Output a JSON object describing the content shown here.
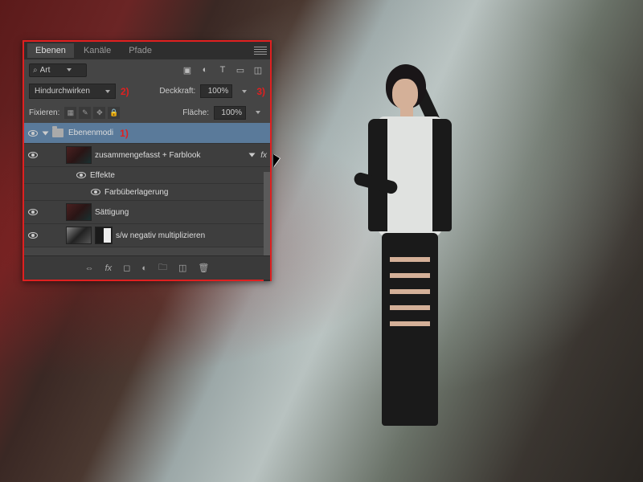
{
  "tabs": {
    "layers": "Ebenen",
    "channels": "Kanäle",
    "paths": "Pfade"
  },
  "filter": {
    "label": "Art"
  },
  "blend": {
    "mode": "Hindurchwirken",
    "opacity_label": "Deckkraft:",
    "opacity_value": "100%"
  },
  "lock": {
    "label": "Fixieren:",
    "fill_label": "Fläche:",
    "fill_value": "100%"
  },
  "annotations": {
    "a1": "1)",
    "a2": "2)",
    "a3": "3)"
  },
  "layers": [
    {
      "name": "Ebenenmodi"
    },
    {
      "name": "zusammengefasst + Farblook"
    },
    {
      "effects_label": "Effekte"
    },
    {
      "effect": "Farbüberlagerung"
    },
    {
      "name": "Sättigung"
    },
    {
      "name": "s/w negativ multiplizieren"
    }
  ],
  "fx": "fx"
}
